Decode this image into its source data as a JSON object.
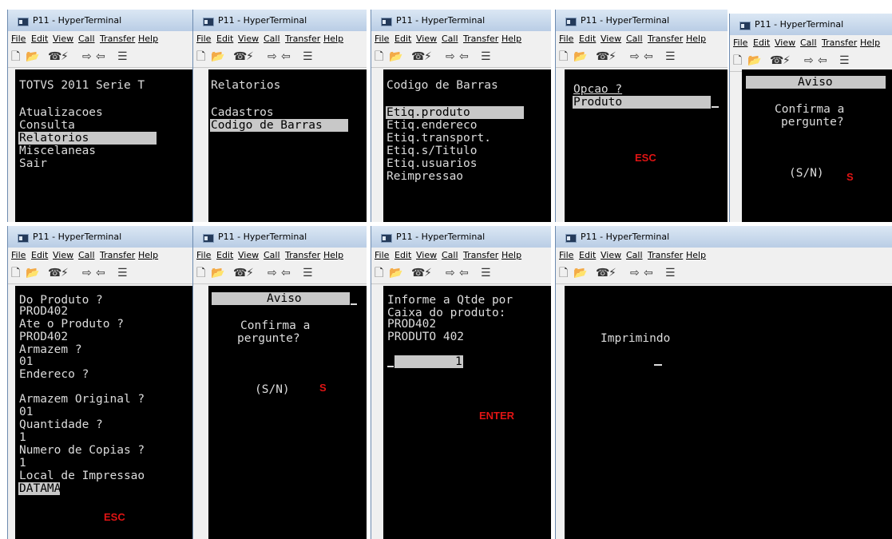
{
  "window_title": "P11 - HyperTerminal",
  "menu": [
    "File",
    "Edit",
    "View",
    "Call",
    "Transfer",
    "Help"
  ],
  "toolbar_icons": [
    "new-icon",
    "open-icon",
    "disconnect-icon",
    "connect-icon",
    "send-icon",
    "receive-icon",
    "properties-icon"
  ],
  "annotations": {
    "esc": "ESC",
    "s": "S",
    "enter": "ENTER"
  },
  "screens": {
    "s1": {
      "title": "TOTVS 2011 Serie T",
      "items": [
        "Atualizacoes",
        "Consulta",
        "Relatorios",
        "Miscelaneas",
        "Sair"
      ],
      "selected": "Relatorios"
    },
    "s2": {
      "title": "Relatorios",
      "items": [
        "Cadastros",
        "Codigo de Barras"
      ],
      "selected": "Codigo de Barras"
    },
    "s3": {
      "title": "Codigo de Barras",
      "items": [
        "Etiq.produto",
        "Etiq.endereco",
        "Etiq.transport.",
        "Etiq.s/Titulo",
        "Etiq.usuarios",
        "Reimpressao"
      ],
      "selected": "Etiq.produto"
    },
    "s4": {
      "prompt": "Opcao ?",
      "value": "Produto"
    },
    "s5": {
      "header": "Aviso",
      "line1": "Confirma a",
      "line2": "pergunte?",
      "options": "(S/N)"
    },
    "s6": {
      "lines": [
        "Do Produto ?",
        "PROD402",
        "Ate o Produto ?",
        "PROD402",
        "Armazem ?",
        "01",
        "Endereco ?",
        "",
        "Armazem Original ?",
        "01",
        "Quantidade ?",
        "1",
        "Numero de Copias ?",
        "1",
        "Local de Impressao"
      ],
      "selected_value": "DATAMA"
    },
    "s7": {
      "header": "Aviso",
      "line1": "Confirma a",
      "line2": "pergunte?",
      "options": "(S/N)"
    },
    "s8": {
      "lines": [
        "Informe a Qtde por",
        "Caixa do produto:",
        "PROD402",
        "PRODUTO 402"
      ],
      "qty": "1"
    },
    "s9": {
      "message": "Imprimindo"
    }
  }
}
